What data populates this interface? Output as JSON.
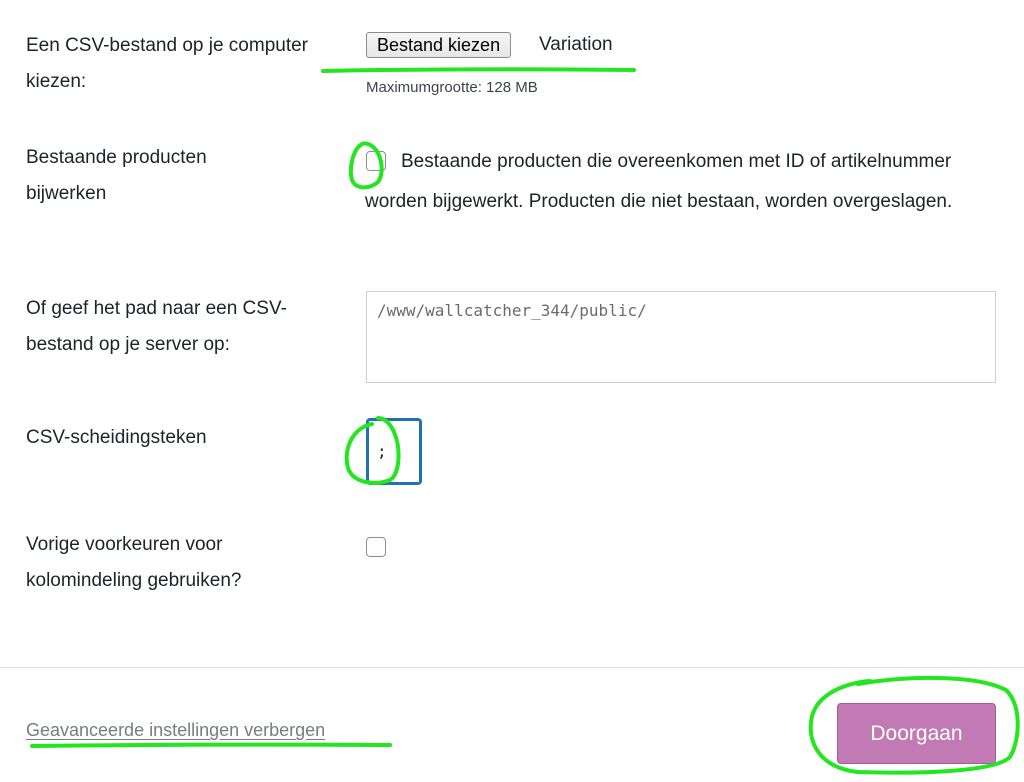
{
  "file_upload": {
    "label": "Een CSV-bestand op je computer kiezen:",
    "button_label": "Bestand kiezen",
    "chosen_file": "Variation",
    "max_size": "Maximumgrootte: 128 MB"
  },
  "update_existing": {
    "label": "Bestaande producten bijwerken",
    "description": "Bestaande producten die overeenkomen met ID of artikelnummer worden bijgewerkt. Producten die niet bestaan, worden overgeslagen.",
    "checked": false
  },
  "server_path": {
    "label": "Of geef het pad naar een CSV-bestand op je server op:",
    "value": "/www/wallcatcher_344/public/"
  },
  "delimiter": {
    "label": "CSV-scheidingsteken",
    "value": ";"
  },
  "previous_mapping": {
    "label": "Vorige voorkeuren voor kolomindeling gebruiken?",
    "checked": false
  },
  "footer": {
    "advanced_link": "Geavanceerde instellingen verbergen",
    "submit_label": "Doorgaan"
  },
  "colors": {
    "accent": "#c27ab4",
    "focus": "#2271b1",
    "annotation": "#22e61e"
  }
}
